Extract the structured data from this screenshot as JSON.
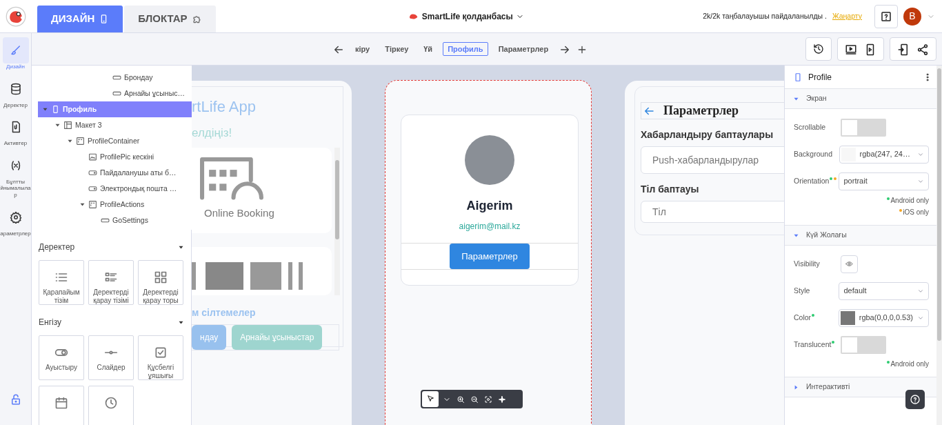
{
  "header": {
    "tabs": [
      {
        "label": "ДИЗАЙН",
        "kind": "phone",
        "selected": true
      },
      {
        "label": "БЛОКТАР",
        "kind": "puzzle",
        "selected": false
      }
    ],
    "project_title": "SmartLife қолданбасы",
    "usage_notice": "2k/2k таңбалауышы пайдаланылды .",
    "upgrade_link": "Жаңарту",
    "avatar_letter": "B"
  },
  "page_nav": {
    "pages": [
      {
        "label": "кіру",
        "selected": false
      },
      {
        "label": "Тіркеу",
        "selected": false
      },
      {
        "label": "Үй",
        "selected": false
      },
      {
        "label": "Профиль",
        "selected": true
      },
      {
        "label": "Параметрлер",
        "selected": false
      }
    ]
  },
  "rail": [
    {
      "label": "Дизайн",
      "kind": "brush",
      "selected": true
    },
    {
      "label": "Деректер",
      "kind": "database",
      "selected": false
    },
    {
      "label": "Активтер",
      "kind": "file",
      "selected": false
    },
    {
      "label": "Бұлтты йнымалылар",
      "kind": "variable",
      "selected": false
    },
    {
      "label": "араметрлер",
      "kind": "gear",
      "selected": false
    }
  ],
  "layer_tree": {
    "partial_items": [
      {
        "label": "Брондау",
        "kind": "button"
      },
      {
        "label": "Арнайы ұсыныс…",
        "kind": "button"
      }
    ],
    "items": [
      {
        "label": "Профиль",
        "kind": "screen",
        "selected": true,
        "expanded": true,
        "children": [
          {
            "label": "Макет 3",
            "kind": "layout",
            "selected": false,
            "expanded": true,
            "children": [
              {
                "label": "ProfileContainer",
                "kind": "container",
                "selected": false,
                "expanded": true,
                "children": [
                  {
                    "label": "ProfilePic кескіні",
                    "kind": "image",
                    "selected": false
                  },
                  {
                    "label": "Пайдаланушы аты б…",
                    "kind": "text",
                    "selected": false
                  },
                  {
                    "label": "Электрондық пошта …",
                    "kind": "text",
                    "selected": false
                  },
                  {
                    "label": "ProfileActions",
                    "kind": "container",
                    "selected": false,
                    "expanded": true,
                    "children": [
                      {
                        "label": "GoSettings",
                        "kind": "button",
                        "selected": false
                      }
                    ]
                  }
                ]
              }
            ]
          }
        ]
      }
    ]
  },
  "palette": [
    {
      "title": "Деректер",
      "expanded": true,
      "items": [
        {
          "label": "Қарапайым тізім",
          "kind": "list"
        },
        {
          "label": "Деректерді қарау тізімі",
          "kind": "datalist"
        },
        {
          "label": "Деректерді қарау торы",
          "kind": "grid"
        }
      ]
    },
    {
      "title": "Енгізу",
      "expanded": true,
      "items": [
        {
          "label": "Ауыстыру",
          "kind": "toggle"
        },
        {
          "label": "Слайдер",
          "kind": "slider"
        },
        {
          "label": "Құсбелгі ұяшығы",
          "kind": "checkbox"
        },
        {
          "kind": "calendar"
        },
        {
          "kind": "clock"
        }
      ]
    }
  ],
  "home_screen": {
    "title": "rtLife App",
    "subtitle": "елдіңіз!",
    "card_label": "Online Booking",
    "links_heading": "м сілтемелер",
    "buttons": [
      {
        "label": "ндау",
        "color": "#98c1ee"
      },
      {
        "label": "Арнайы ұсыныстар",
        "color": "#9ed5cf"
      }
    ]
  },
  "profile_screen": {
    "name": "Aigerim",
    "email": "aigerim@mail.kz",
    "button": "Параметрлер"
  },
  "settings_screen": {
    "title": "Параметрлер",
    "sections": [
      {
        "label": "Хабарландыру баптаулары",
        "field": "Push-хабарландырулар"
      },
      {
        "label": "Тіл баптауы",
        "placeholder": "Тіл"
      }
    ]
  },
  "properties": {
    "title": "Profile",
    "sections": [
      {
        "title": "Экран",
        "expanded": true,
        "fields": [
          {
            "label": "Scrollable",
            "kind": "toggle",
            "on": false
          },
          {
            "label": "Background",
            "kind": "color_select",
            "value": "rgba(247, 24…",
            "color": "#f7f7f7"
          },
          {
            "label": "Orientation",
            "kind": "select",
            "value": "portrait",
            "markers": [
              {
                "color": "#2ecc71"
              },
              {
                "color": "#f5a623"
              }
            ]
          }
        ],
        "notes": [
          {
            "text": "Android only",
            "color": "#2ecc71"
          },
          {
            "text": "iOS only",
            "color": "#f5a623"
          }
        ]
      },
      {
        "title": "Күй Жолағы",
        "expanded": true,
        "fields": [
          {
            "label": "Visibility",
            "kind": "eye_button"
          },
          {
            "label": "Style",
            "kind": "select",
            "value": "default"
          },
          {
            "label": "Color",
            "kind": "color_select",
            "value": "rgba(0,0,0,0.53)",
            "color": "#777777",
            "markers": [
              {
                "color": "#2ecc71"
              }
            ]
          },
          {
            "label": "Translucent",
            "kind": "toggle",
            "on": false,
            "markers": [
              {
                "color": "#2ecc71"
              }
            ]
          }
        ],
        "notes": [
          {
            "text": "Android only",
            "color": "#2ecc71"
          }
        ]
      },
      {
        "title": "Интерактивті",
        "expanded": false
      }
    ]
  }
}
